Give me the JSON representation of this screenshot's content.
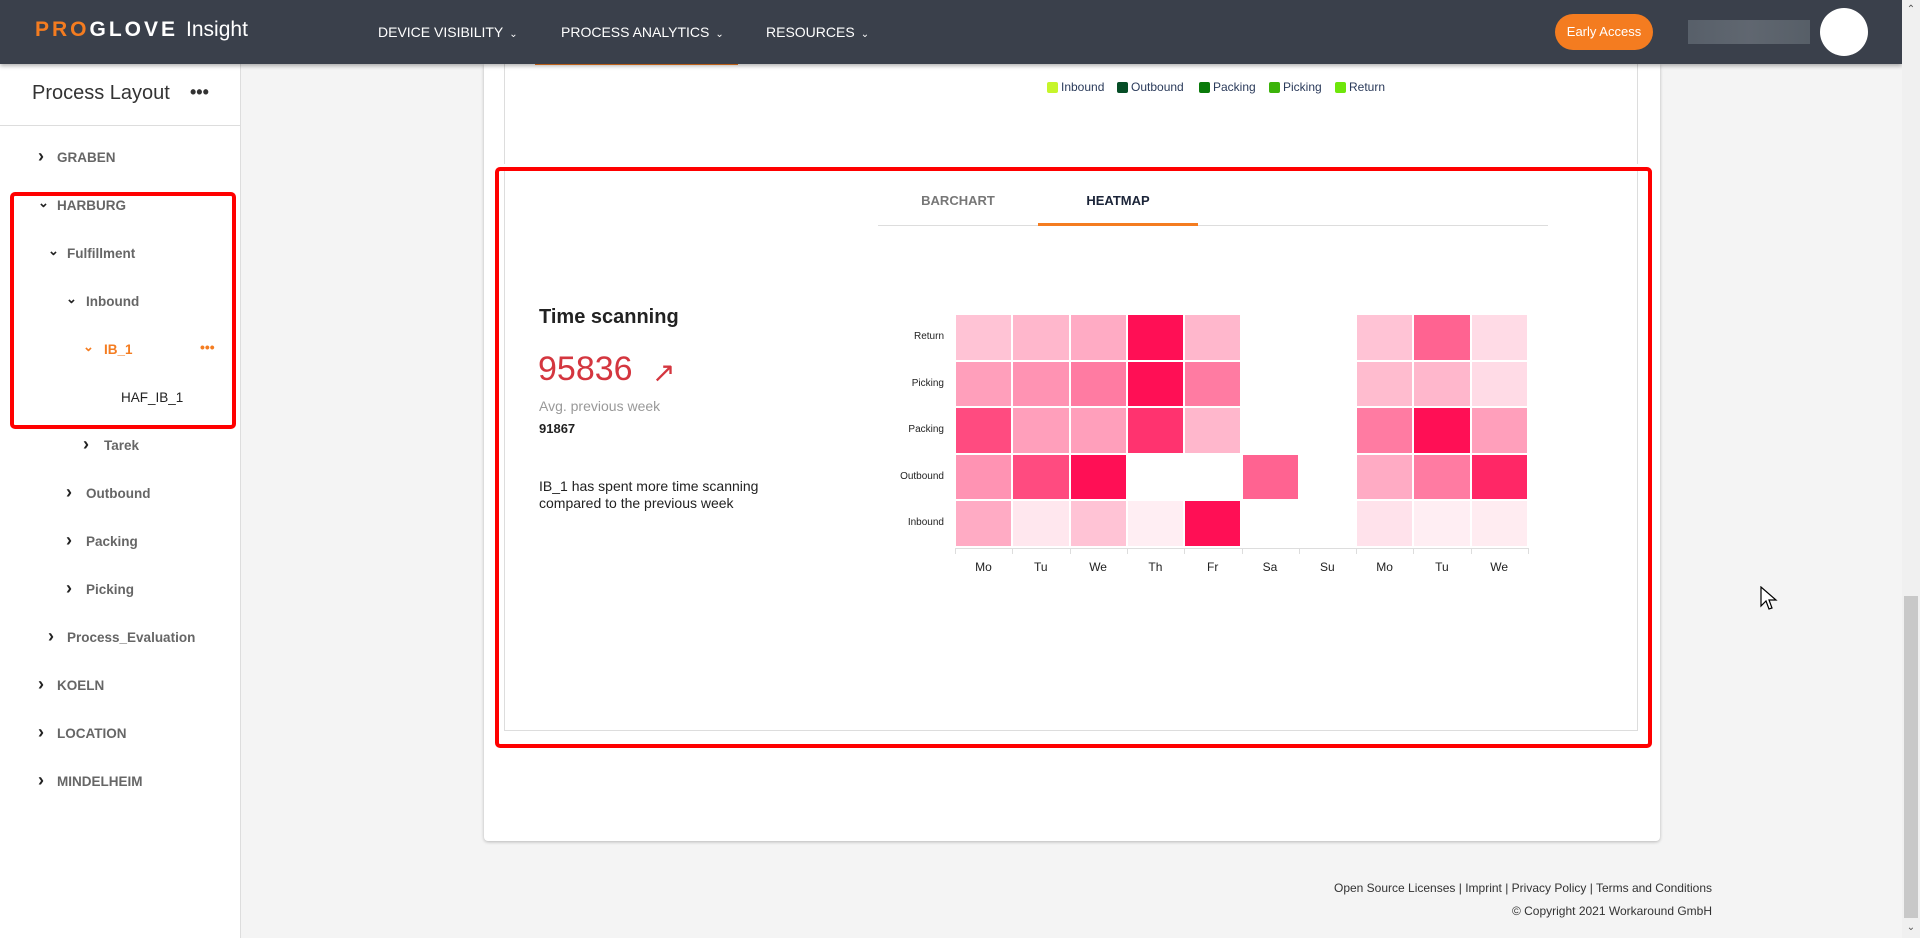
{
  "header": {
    "brand_pro": "PRO",
    "brand_glove": "GLOVE",
    "brand_insight": "Insight",
    "nav": [
      {
        "label": "DEVICE VISIBILITY"
      },
      {
        "label": "PROCESS ANALYTICS"
      },
      {
        "label": "RESOURCES"
      }
    ],
    "early_access": "Early Access"
  },
  "sidebar": {
    "title": "Process Layout",
    "more": "•••",
    "items": [
      {
        "label": "GRABEN",
        "expanded": false
      },
      {
        "label": "HARBURG",
        "expanded": true
      },
      {
        "label": "Fulfillment",
        "expanded": true
      },
      {
        "label": "Inbound",
        "expanded": true
      },
      {
        "label": "IB_1",
        "expanded": true,
        "active": true
      },
      {
        "label": "HAF_IB_1"
      },
      {
        "label": "Tarek",
        "expanded": false
      },
      {
        "label": "Outbound",
        "expanded": false
      },
      {
        "label": "Packing",
        "expanded": false
      },
      {
        "label": "Picking",
        "expanded": false
      },
      {
        "label": "Process_Evaluation",
        "expanded": false
      },
      {
        "label": "KOELN",
        "expanded": false
      },
      {
        "label": "LOCATION",
        "expanded": false
      },
      {
        "label": "MINDELHEIM",
        "expanded": false
      }
    ]
  },
  "top_chart": {
    "legend": [
      {
        "name": "Inbound",
        "color": "#c6f52a"
      },
      {
        "name": "Outbound",
        "color": "#064d26"
      },
      {
        "name": "Packing",
        "color": "#0a7a0a"
      },
      {
        "name": "Picking",
        "color": "#3cb30a"
      },
      {
        "name": "Return",
        "color": "#6ee60a"
      }
    ]
  },
  "tabs": [
    {
      "label": "BARCHART",
      "active": false
    },
    {
      "label": "HEATMAP",
      "active": true
    }
  ],
  "metric": {
    "title": "Time scanning",
    "value": "95836",
    "trend": "↗",
    "avg_label": "Avg. previous week",
    "avg_value": "91867",
    "description": "IB_1 has spent more time scanning compared to the previous week"
  },
  "chart_data": {
    "type": "heatmap",
    "x": [
      "Mo",
      "Tu",
      "We",
      "Th",
      "Fr",
      "Sa",
      "Su",
      "Mo",
      "Tu",
      "We"
    ],
    "y": [
      "Return",
      "Picking",
      "Packing",
      "Outbound",
      "Inbound"
    ],
    "color": "#ff0f55",
    "intensity": [
      [
        0.25,
        0.3,
        0.35,
        1,
        0.3,
        null,
        null,
        0.25,
        0.65,
        0.15
      ],
      [
        0.4,
        0.45,
        0.55,
        1,
        0.55,
        null,
        null,
        0.28,
        0.3,
        0.15
      ],
      [
        0.75,
        0.4,
        0.4,
        0.85,
        0.3,
        null,
        null,
        0.55,
        1,
        0.4
      ],
      [
        0.45,
        0.75,
        1,
        null,
        null,
        0.65,
        null,
        0.35,
        0.55,
        0.9
      ],
      [
        0.35,
        0.1,
        0.25,
        0.07,
        1,
        null,
        null,
        0.12,
        0.07,
        0.08
      ]
    ]
  },
  "footer": {
    "links": [
      "Open Source Licenses",
      "Imprint",
      "Privacy Policy",
      "Terms and Conditions"
    ],
    "separator": " | ",
    "copyright": "© Copyright 2021 Workaround GmbH"
  }
}
